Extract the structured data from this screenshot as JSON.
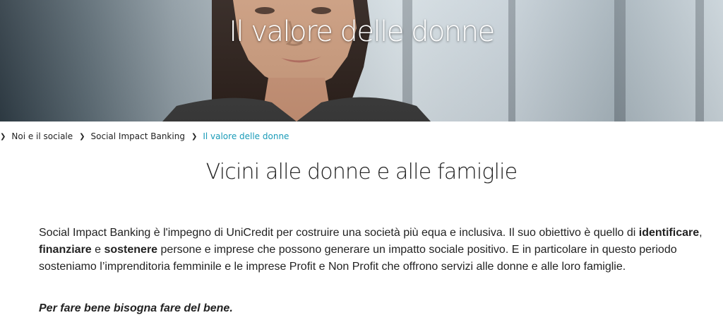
{
  "hero": {
    "title": "Il valore delle donne"
  },
  "breadcrumb": {
    "items": [
      "Noi e il sociale",
      "Social Impact Banking"
    ],
    "current": "Il valore delle donne"
  },
  "section": {
    "title": "Vicini alle donne e alle famiglie"
  },
  "intro": {
    "part1": "Social Impact Banking è l'impegno di UniCredit per costruire una società più equa e inclusiva. Il suo obiettivo è quello di ",
    "bold1": "identificare",
    "sep1": ", ",
    "bold2": "finanziare",
    "sep2": " e ",
    "bold3": "sostenere",
    "part2": " persone e imprese che possono generare un impatto sociale positivo. E in particolare in questo periodo sosteniamo l’imprenditoria femminile e le imprese Profit e Non Profit che offrono servizi alle donne e alle loro famiglie."
  },
  "tagline": "Per fare bene bisogna fare del bene.",
  "icons": {
    "breadcrumb_separator": "chevron-right-icon"
  },
  "colors": {
    "breadcrumb_current": "#1a9bb8",
    "text": "#222222",
    "hero_title": "#ffffff"
  }
}
